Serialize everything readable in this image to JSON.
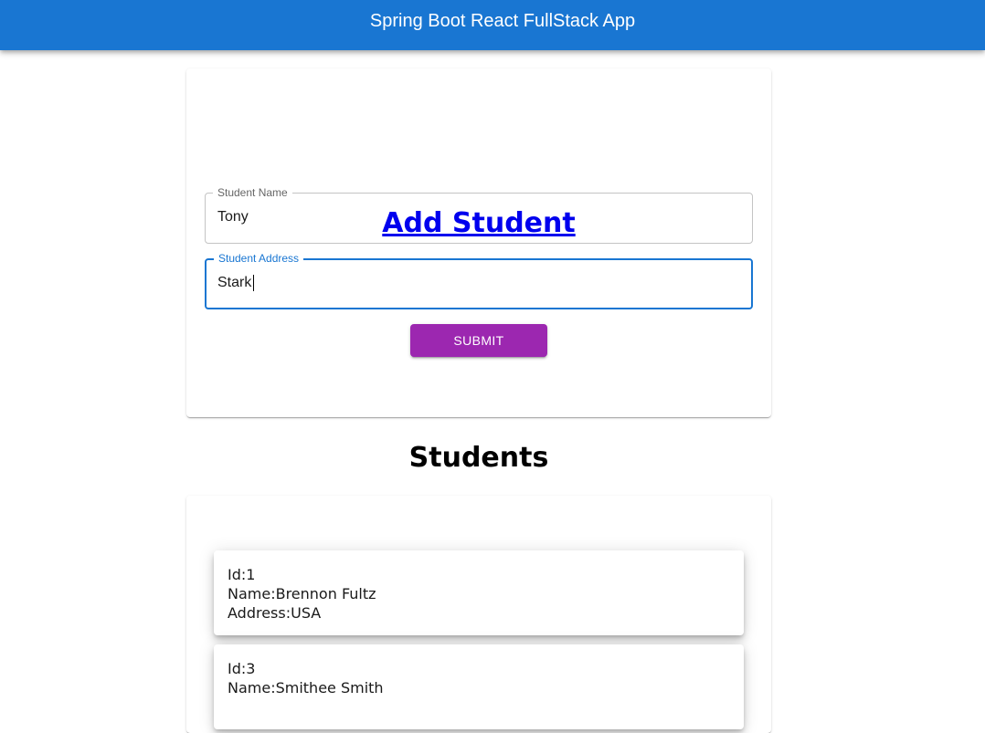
{
  "appbar": {
    "title": "Spring Boot React FullStack App"
  },
  "form": {
    "heading": "Add Student",
    "name_field": {
      "label": "Student Name",
      "value": "Tony"
    },
    "address_field": {
      "label": "Student Address",
      "value": "Stark"
    },
    "submit_label": "Submit"
  },
  "students_section": {
    "heading": "Students",
    "students": [
      {
        "id_text": "Id:1",
        "name_text": "Name:Brennon Fultz",
        "address_text": "Address:USA"
      },
      {
        "id_text": "Id:3",
        "name_text": "Name:Smithee Smith"
      }
    ]
  },
  "colors": {
    "appbar": "#1976d2",
    "focus": "#1976d2",
    "submit": "#9c27b0",
    "link": "#0000ee"
  }
}
